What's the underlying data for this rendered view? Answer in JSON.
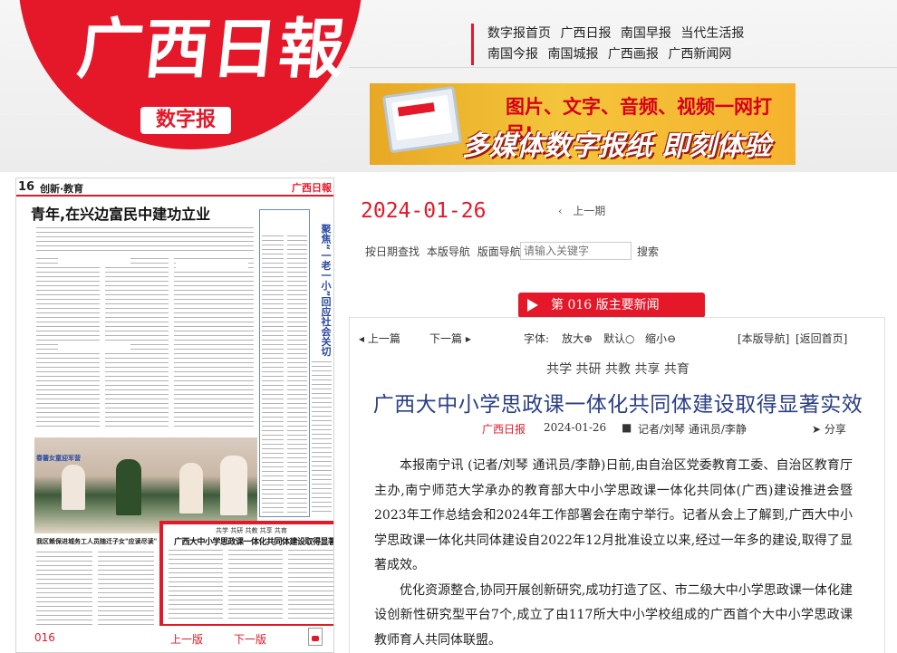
{
  "brand": {
    "logo_text": "广西日報",
    "badge": "数字报"
  },
  "toplinks": {
    "row1": [
      "数字报首页",
      "广西日报",
      "南国早报",
      "当代生活报"
    ],
    "row2": [
      "南国今报",
      "南国城报",
      "广西画报",
      "广西新闻网"
    ]
  },
  "banner": {
    "line1": "图片、文字、音频、视频一网打尽!",
    "line2": "多媒体数字报纸 即刻体验"
  },
  "thumbnail": {
    "page_number": "16",
    "section": "创新·教育",
    "mini_logo": "广西日報",
    "headline": "青年,在兴边富民中建功立业",
    "side_head": "聚焦“一老一小”回应社会关切",
    "photo_caption": "春蕾女童迎军营",
    "bottom_head": "我区赖保进城务工人员随迁子女\"应读尽读\"",
    "highlight_tags": "共学 共研 共教 共享 共育",
    "highlight_title": "广西大中小学思政课一体化共同体建设取得显著实效",
    "footer_page": "016",
    "footer_prev": "上一版",
    "footer_next": "下一版"
  },
  "date": "2024-01-26",
  "prev_top": "上一期",
  "navbar": {
    "by_date": "按日期查找",
    "page_nav": "本版导航",
    "layout_nav": "版面导航"
  },
  "search": {
    "placeholder": "请输入关键字",
    "button": "搜索"
  },
  "section_pill": "第 016 版主要新闻",
  "article_nav": {
    "prev": "上一篇",
    "next": "下一篇",
    "font_label": "字体:",
    "larger": "放大",
    "default": "默认",
    "smaller": "缩小",
    "page_nav": "[本版导航]",
    "home": "[返回首页]"
  },
  "article": {
    "tags": "共学 共研 共教 共享 共育",
    "title": "广西大中小学思政课一体化共同体建设取得显著实效",
    "source": "广西日报",
    "date": "2024-01-26",
    "authors": "记者/刘琴 通讯员/李静",
    "share": "分享",
    "paragraphs": [
      "本报南宁讯 (记者/刘琴 通讯员/李静)日前,由自治区党委教育工委、自治区教育厅主办,南宁师范大学承办的教育部大中小学思政课一体化共同体(广西)建设推进会暨2023年工作总结会和2024年工作部署会在南宁举行。记者从会上了解到,广西大中小学思政课一体化共同体建设自2022年12月批准设立以来,经过一年多的建设,取得了显著成效。",
      "优化资源整合,协同开展创新研究,成功打造了区、市二级大中小学思政课一体化建设创新性研究型平台7个,成立了由117所大中小学校组成的广西首个大中小学思政课教师育人共同体联盟。"
    ]
  },
  "colors": {
    "accent": "#e5182a",
    "title_blue": "#2b3f86",
    "banner_orange": "#f3c53a"
  }
}
